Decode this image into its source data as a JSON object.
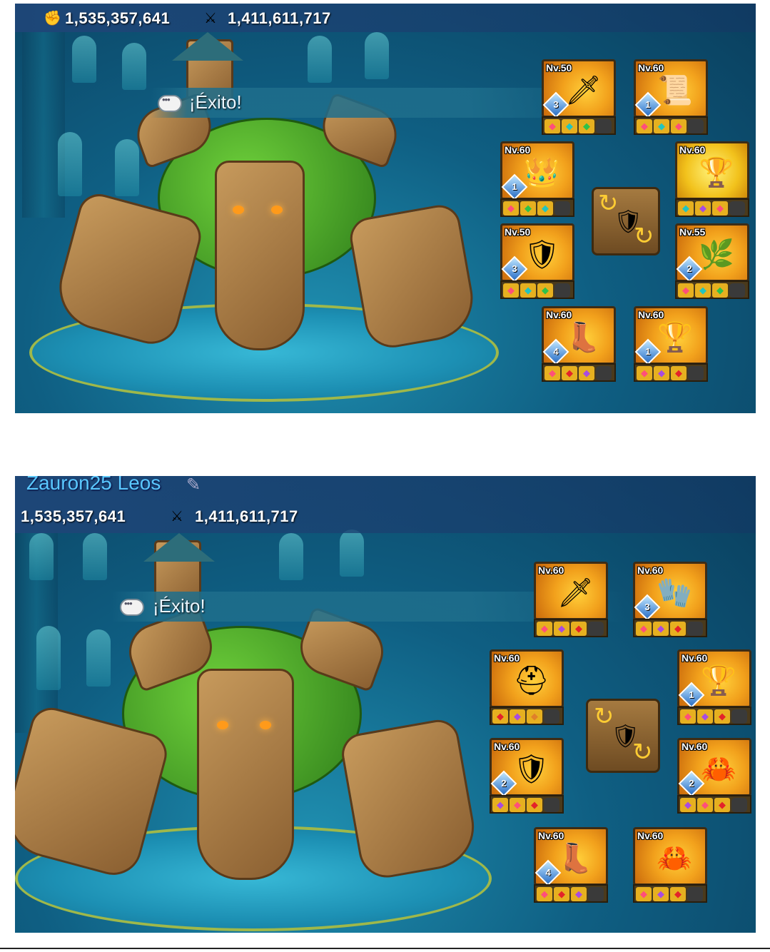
{
  "screens": [
    {
      "stats": {
        "might": "1,535,357,641",
        "kills": "1,411,611,717"
      },
      "username": "",
      "banner": "¡Éxito!",
      "gear": [
        {
          "level": "Nv.50",
          "gem": "3",
          "slots": [
            "ruby",
            "teal",
            "green",
            "empty"
          ]
        },
        {
          "level": "Nv.60",
          "gem": "1",
          "slots": [
            "ruby",
            "teal",
            "ruby",
            "empty"
          ]
        },
        {
          "level": "Nv.60",
          "gem": "1",
          "slots": [
            "ruby",
            "green",
            "teal",
            "empty"
          ]
        },
        {
          "level": "Nv.60",
          "gem": "",
          "slots": [
            "teal",
            "purple",
            "ruby",
            "empty"
          ]
        },
        {
          "level": "Nv.50",
          "gem": "3",
          "slots": [
            "ruby",
            "teal",
            "green",
            "empty"
          ]
        },
        {
          "level": "Nv.55",
          "gem": "2",
          "slots": [
            "ruby",
            "teal",
            "green",
            "empty"
          ]
        },
        {
          "level": "Nv.60",
          "gem": "4",
          "slots": [
            "ruby",
            "red",
            "purple",
            "empty"
          ]
        },
        {
          "level": "Nv.60",
          "gem": "1",
          "slots": [
            "ruby",
            "purple",
            "red",
            "empty"
          ]
        }
      ]
    },
    {
      "stats": {
        "might": "1,535,357,641",
        "kills": "1,411,611,717"
      },
      "username": "Zauron25 Leos",
      "banner": "¡Éxito!",
      "gear": [
        {
          "level": "Nv.60",
          "gem": "",
          "slots": [
            "ruby",
            "purple",
            "red",
            "empty"
          ]
        },
        {
          "level": "Nv.60",
          "gem": "3",
          "slots": [
            "ruby",
            "purple",
            "red",
            "empty"
          ]
        },
        {
          "level": "Nv.60",
          "gem": "",
          "slots": [
            "red",
            "purple",
            "orange",
            "empty"
          ]
        },
        {
          "level": "Nv.60",
          "gem": "1",
          "slots": [
            "ruby",
            "purple",
            "red",
            "empty"
          ]
        },
        {
          "level": "Nv.60",
          "gem": "2",
          "slots": [
            "purple",
            "ruby",
            "red",
            "empty"
          ]
        },
        {
          "level": "Nv.60",
          "gem": "2",
          "slots": [
            "purple",
            "ruby",
            "red",
            "empty"
          ]
        },
        {
          "level": "Nv.60",
          "gem": "4",
          "slots": [
            "ruby",
            "red",
            "purple",
            "empty"
          ]
        },
        {
          "level": "Nv.60",
          "gem": "",
          "slots": [
            "ruby",
            "purple",
            "red",
            "empty"
          ]
        }
      ]
    }
  ],
  "icons": {
    "might": "fist-icon",
    "kills": "crossed-swords-icon",
    "chat": "chat-bubble-icon",
    "swap": "swap-gear-icon",
    "username_badge": "quill-icon"
  },
  "colors": {
    "ruby": "#ff4f7a",
    "teal": "#22c4c0",
    "green": "#2fc24a",
    "purple": "#a84ce0",
    "red": "#e3232a",
    "orange": "#e0802a",
    "empty": "#3a3a3a"
  }
}
